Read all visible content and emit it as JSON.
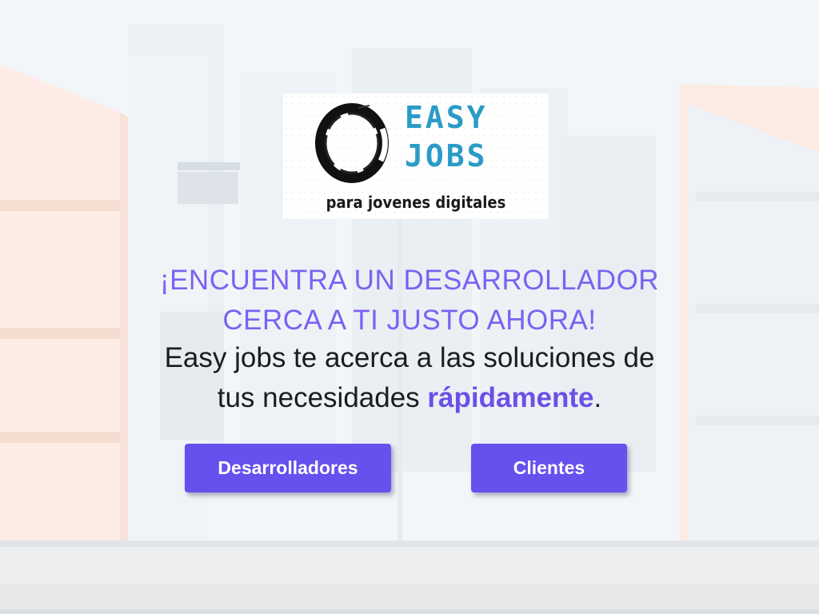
{
  "logo": {
    "word1": "EASY",
    "word2": "JOBS",
    "tagline": "para jovenes digitales"
  },
  "hero": {
    "headline_line1": "¡ENCUENTRA UN DESARROLLADOR",
    "headline_line2": "CERCA A TI JUSTO AHORA!",
    "subline_line1": "Easy jobs te acerca a las soluciones de",
    "subline_line2_prefix": "tus necesidades ",
    "subline_line2_emphasis": "rápidamente",
    "subline_line2_suffix": "."
  },
  "buttons": {
    "developers_label": "Desarrolladores",
    "clients_label": "Clientes"
  },
  "colors": {
    "accent": "#6650ee",
    "headline": "#7b62f2",
    "logo_blue": "#2a9bc6"
  }
}
